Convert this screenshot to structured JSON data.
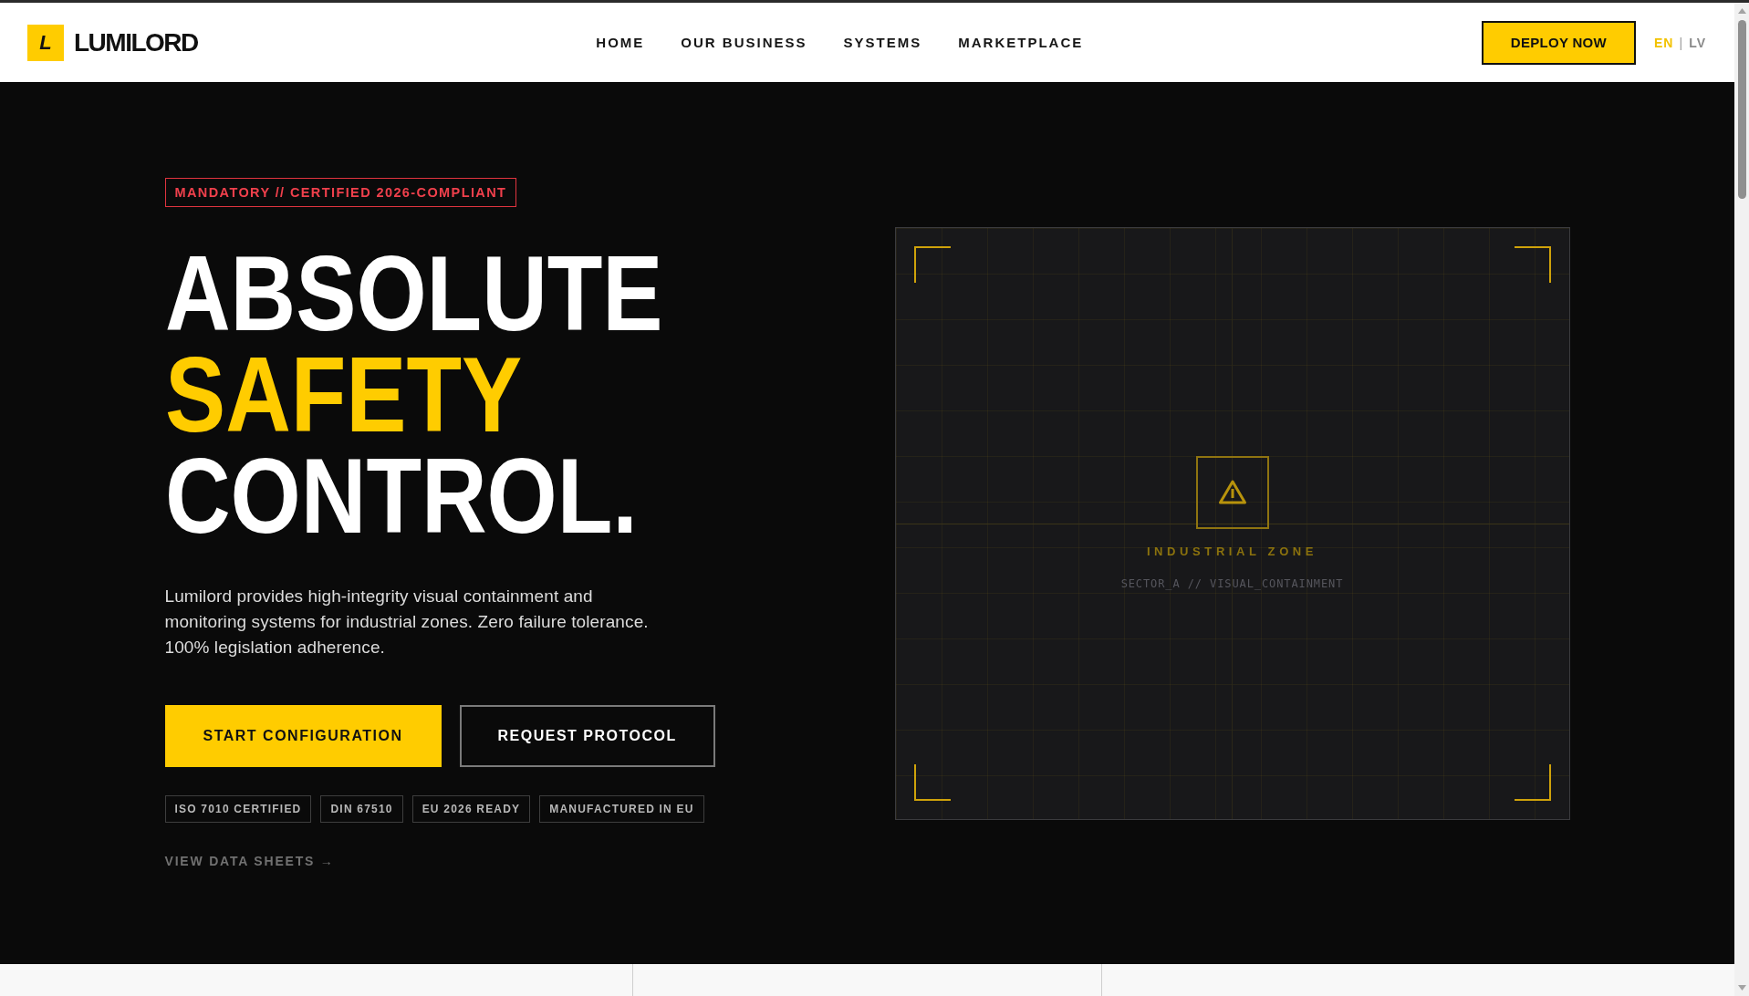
{
  "header": {
    "logo": {
      "mark": "L",
      "name": "LUMILORD"
    },
    "nav": [
      "HOME",
      "OUR BUSINESS",
      "SYSTEMS",
      "MARKETPLACE"
    ],
    "cta": "DEPLOY NOW",
    "languages": [
      {
        "label": "EN",
        "selected": true
      },
      {
        "label": "LV",
        "selected": false
      }
    ],
    "language_separator": "|"
  },
  "hero": {
    "badge": "MANDATORY // CERTIFIED 2026-COMPLIANT",
    "headline": [
      {
        "text": "ABSOLUTE",
        "highlight": false
      },
      {
        "text": "SAFETY",
        "highlight": true
      },
      {
        "text": "CONTROL.",
        "highlight": false
      }
    ],
    "description": "Lumilord provides high-integrity visual containment and monitoring systems for industrial zones. Zero failure tolerance. 100% legislation adherence.",
    "buttons": [
      {
        "label": "START CONFIGURATION",
        "kind": "primary"
      },
      {
        "label": "REQUEST PROTOCOL",
        "kind": "outline"
      }
    ],
    "tags": [
      "ISO 7010 CERTIFIED",
      "DIN 67510",
      "EU 2026 READY",
      "MANUFACTURED IN EU"
    ],
    "link": "VIEW DATA SHEETS →"
  },
  "zone_panel": {
    "title": "INDUSTRIAL ZONE",
    "subtitle": "SECTOR_A // VISUAL_CONTAINMENT"
  }
}
